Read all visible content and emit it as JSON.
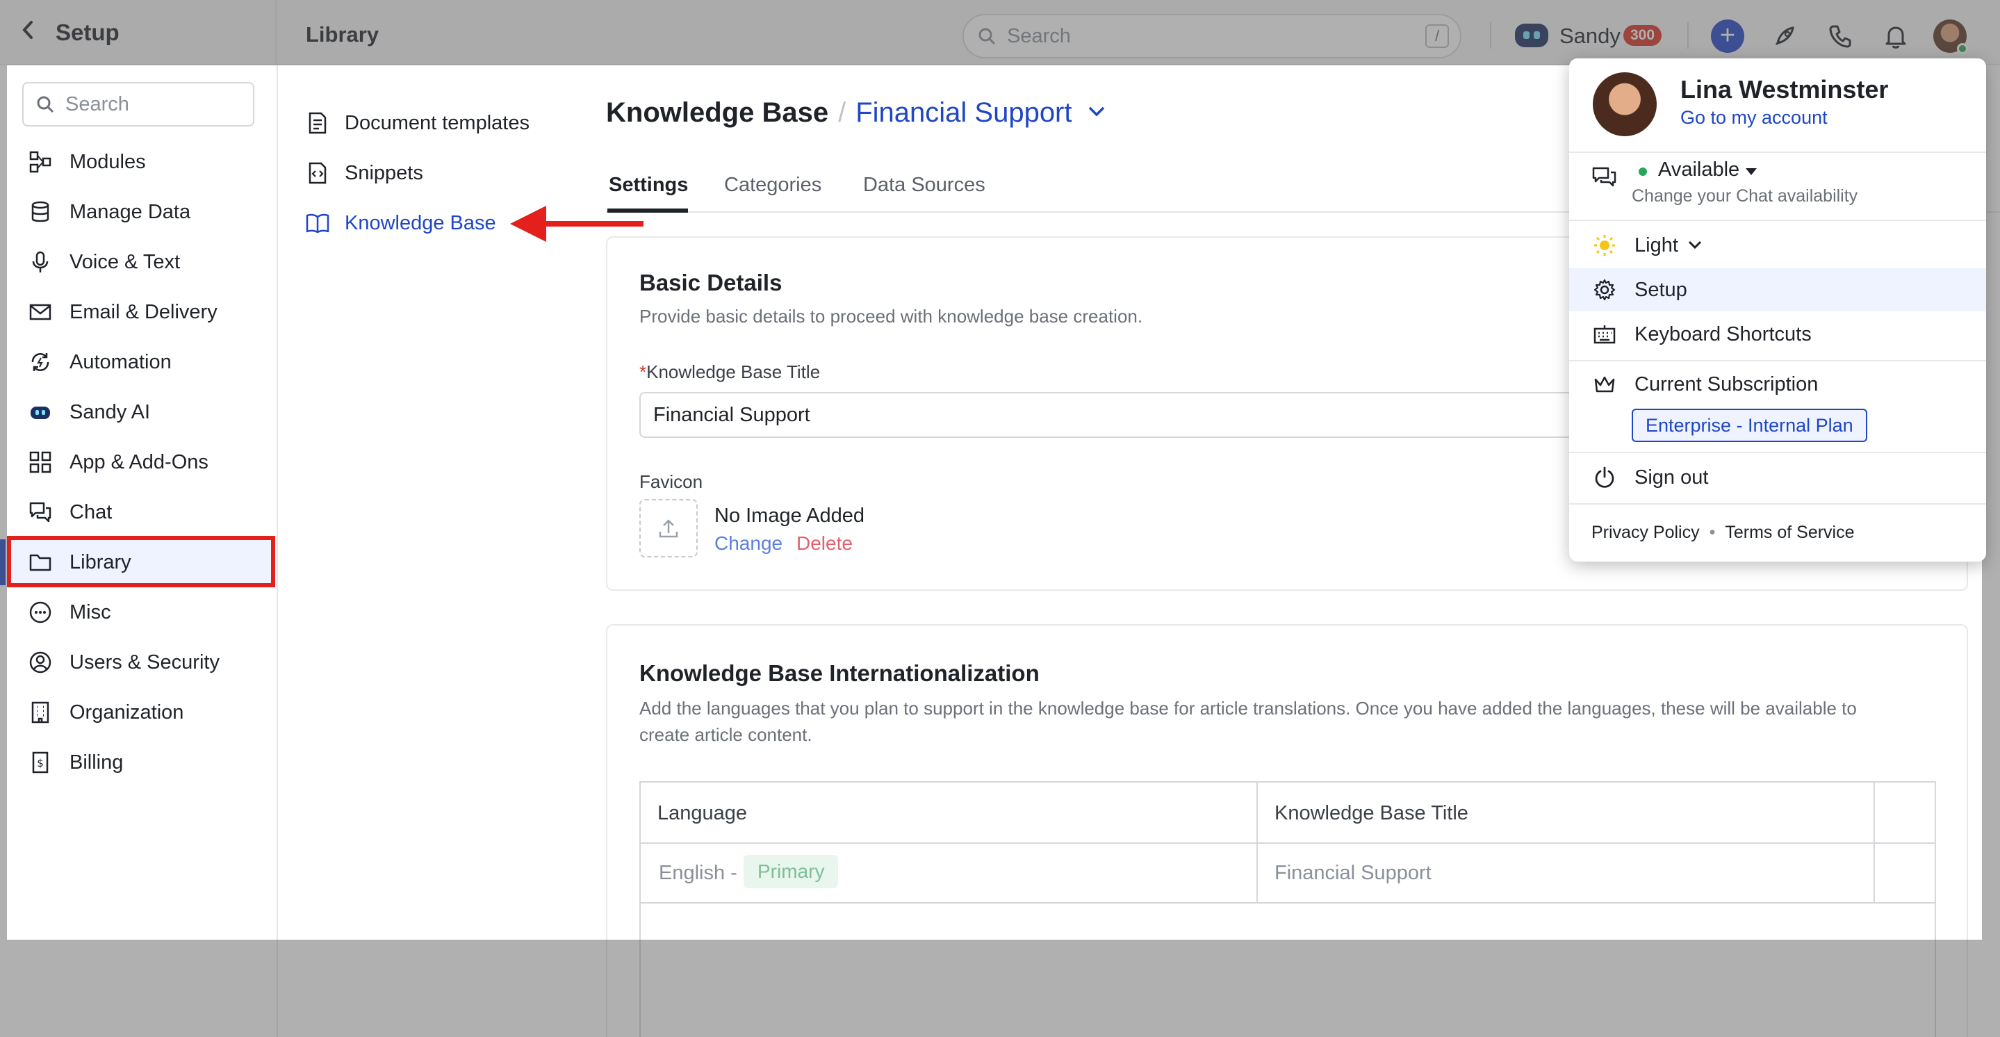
{
  "topbar": {
    "setup_title": "Setup",
    "page_title": "Library",
    "search_placeholder": "Search",
    "search_shortcut": "/",
    "assistant_name": "Sandy",
    "assistant_badge": "300"
  },
  "sidebar": {
    "search_placeholder": "Search",
    "items": [
      {
        "label": "Modules",
        "icon": "modules-icon"
      },
      {
        "label": "Manage Data",
        "icon": "database-icon"
      },
      {
        "label": "Voice & Text",
        "icon": "microphone-icon"
      },
      {
        "label": "Email & Delivery",
        "icon": "envelope-icon"
      },
      {
        "label": "Automation",
        "icon": "automation-icon"
      },
      {
        "label": "Sandy AI",
        "icon": "bot-icon"
      },
      {
        "label": "App & Add-Ons",
        "icon": "grid-icon"
      },
      {
        "label": "Chat",
        "icon": "chat-icon"
      },
      {
        "label": "Library",
        "icon": "folder-icon"
      },
      {
        "label": "Misc",
        "icon": "ellipsis-icon"
      },
      {
        "label": "Users & Security",
        "icon": "user-circle-icon"
      },
      {
        "label": "Organization",
        "icon": "building-icon"
      },
      {
        "label": "Billing",
        "icon": "receipt-icon"
      }
    ],
    "active": "Library"
  },
  "subnav": {
    "items": [
      {
        "label": "Document templates",
        "icon": "document-icon"
      },
      {
        "label": "Snippets",
        "icon": "snippet-icon"
      },
      {
        "label": "Knowledge Base",
        "icon": "book-icon"
      }
    ],
    "active": "Knowledge Base"
  },
  "main": {
    "breadcrumb_root": "Knowledge Base",
    "breadcrumb_separator": "/",
    "breadcrumb_current": "Financial Support",
    "tabs": [
      "Settings",
      "Categories",
      "Data Sources"
    ],
    "active_tab": "Settings",
    "basic": {
      "title": "Basic Details",
      "subtitle": "Provide basic details to proceed with knowledge base creation.",
      "kb_title_required": "*",
      "kb_title_label": "Knowledge Base Title",
      "kb_title_value": "Financial Support",
      "favicon_label": "Favicon",
      "no_image": "No Image Added",
      "change": "Change",
      "delete": "Delete"
    },
    "i18n": {
      "title": "Knowledge Base Internationalization",
      "description_line1": "Add the languages that you plan to support in the knowledge base for article translations. Once you have added the languages, these will be available to",
      "description_line2": "create article content.",
      "columns": [
        "Language",
        "Knowledge Base Title"
      ],
      "rows": [
        {
          "language": "English -",
          "badge": "Primary",
          "title": "Financial Support"
        }
      ]
    }
  },
  "profile_menu": {
    "name": "Lina Westminster",
    "account_link": "Go to my account",
    "availability": "Available",
    "availability_sub": "Change your Chat availability",
    "theme": "Light",
    "setup": "Setup",
    "shortcuts": "Keyboard Shortcuts",
    "subscription": "Current Subscription",
    "plan": "Enterprise - Internal Plan",
    "signout": "Sign out",
    "privacy": "Privacy Policy",
    "terms": "Terms of Service",
    "footer_dot": "•"
  },
  "colors": {
    "accent": "#1f46c5",
    "highlight": "#e3201b",
    "available": "#26a65b",
    "badge": "#d93025"
  }
}
